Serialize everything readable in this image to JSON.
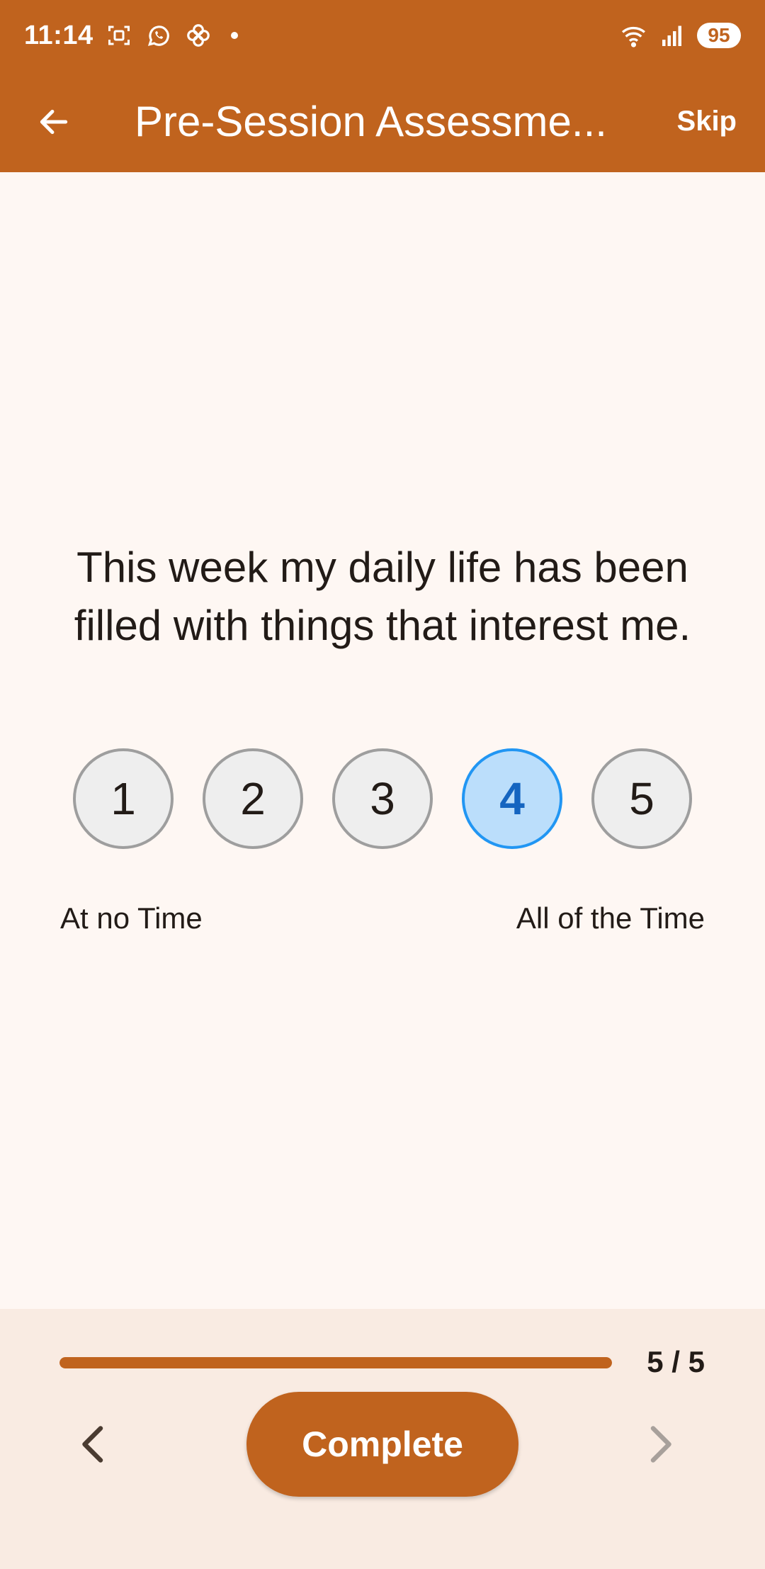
{
  "status_bar": {
    "time": "11:14",
    "battery": "95",
    "icons": [
      "screenshot-icon",
      "whatsapp-icon",
      "app-icon",
      "notification-dot-icon",
      "wifi-icon",
      "signal-icon",
      "battery-icon"
    ]
  },
  "app_bar": {
    "title": "Pre-Session Assessme...",
    "skip_label": "Skip",
    "back_icon": "arrow-left-icon"
  },
  "question": {
    "text": "This week my daily life has been filled with things that interest me."
  },
  "scale": {
    "options": [
      "1",
      "2",
      "3",
      "4",
      "5"
    ],
    "selected": "4",
    "min_label": "At no Time",
    "max_label": "All of the Time"
  },
  "footer": {
    "progress_text": "5 / 5",
    "progress_fraction": 1.0,
    "complete_label": "Complete",
    "prev_icon": "chevron-left-icon",
    "next_icon": "chevron-right-icon"
  },
  "colors": {
    "accent": "#c0631e",
    "background": "#fef7f3",
    "panel": "#f9ebe2",
    "selected_fill": "#bbdefb",
    "selected_border": "#2196f3"
  }
}
